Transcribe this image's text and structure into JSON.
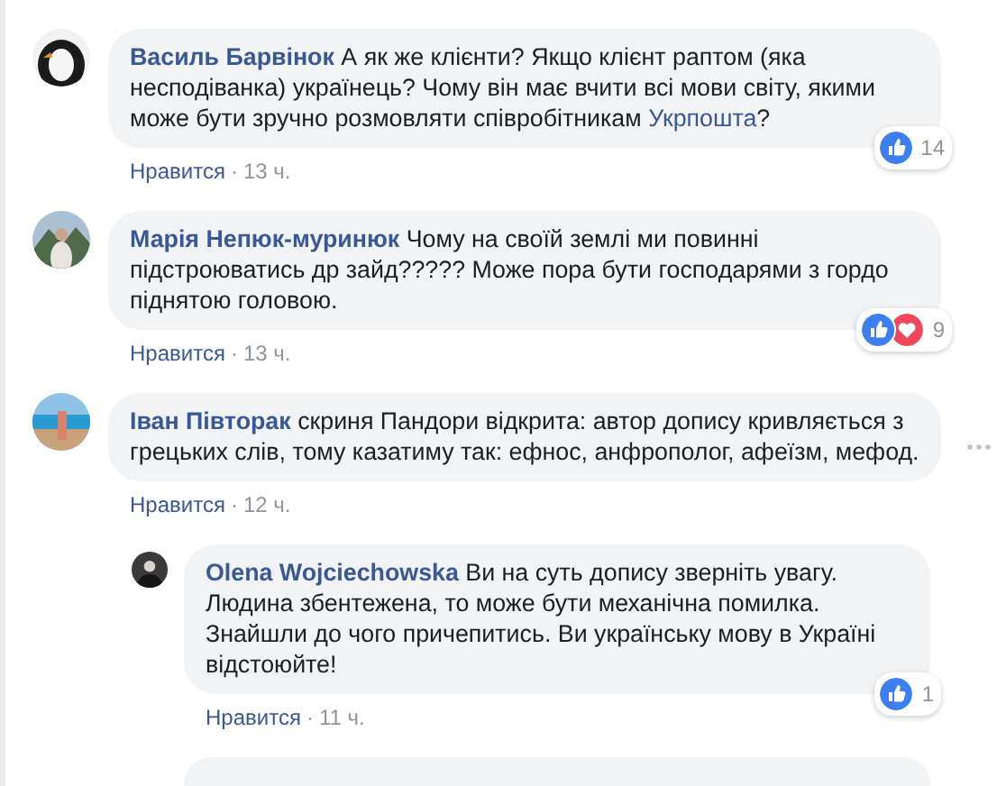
{
  "comments": [
    {
      "author": "Василь Барвінок",
      "reply": false,
      "segments": [
        {
          "kind": "text",
          "text": "А як же клієнти? Якщо клієнт раптом (яка несподіванка) українець? Чому він має вчити всі мови світу, якими може бути зручно розмовляти співробітникам "
        },
        {
          "kind": "link",
          "text": "Укрпошта"
        },
        {
          "kind": "text",
          "text": "?"
        }
      ],
      "like": "Нравится",
      "separator": "·",
      "time": "13 ч.",
      "reactions": [
        {
          "kind": "like"
        }
      ],
      "reaction_count": "14",
      "options": false
    },
    {
      "author": "Марія Непюк-муринюк",
      "reply": false,
      "segments": [
        {
          "kind": "text",
          "text": "Чому на своїй землі ми повинні підстроюватись др зайд????? Може пора бути господарями з гордо піднятою головою."
        }
      ],
      "like": "Нравится",
      "separator": "·",
      "time": "13 ч.",
      "reactions": [
        {
          "kind": "like"
        },
        {
          "kind": "love"
        }
      ],
      "reaction_count": "9",
      "options": false
    },
    {
      "author": "Іван Півторак",
      "reply": false,
      "segments": [
        {
          "kind": "text",
          "text": "скриня Пандори відкрита: автор допису кривляється з грецьких слів, тому казатиму так: ефнос, анфрополог, афеїзм, мефод."
        }
      ],
      "like": "Нравится",
      "separator": "·",
      "time": "12 ч.",
      "options": true
    },
    {
      "author": "Olena Wojciechowska",
      "reply": true,
      "segments": [
        {
          "kind": "text",
          "text": "Ви на суть допису зверніть увагу. Людина збентежена, то може бути механічна помилка. Знайшли до чого причепитись. Ви українську мову в Україні відстоюйте!"
        }
      ],
      "like": "Нравится",
      "separator": "·",
      "time": "11 ч.",
      "reactions": [
        {
          "kind": "like"
        }
      ],
      "reaction_count": "1",
      "options": false
    }
  ]
}
